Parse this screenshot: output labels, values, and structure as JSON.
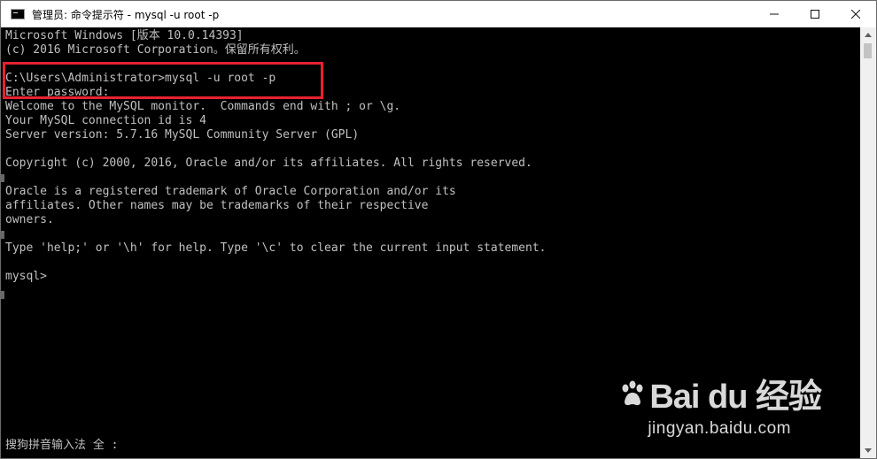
{
  "window": {
    "title": "管理员: 命令提示符 - mysql  -u root -p",
    "controls": {
      "minimize": "minimize-icon",
      "maximize": "maximize-icon",
      "close": "close-icon"
    }
  },
  "console": {
    "lines": [
      "Microsoft Windows [版本 10.0.14393]",
      "(c) 2016 Microsoft Corporation。保留所有权利。",
      "",
      "C:\\Users\\Administrator>mysql -u root -p",
      "Enter password:",
      "Welcome to the MySQL monitor.  Commands end with ; or \\g.",
      "Your MySQL connection id is 4",
      "Server version: 5.7.16 MySQL Community Server (GPL)",
      "",
      "Copyright (c) 2000, 2016, Oracle and/or its affiliates. All rights reserved.",
      "",
      "Oracle is a registered trademark of Oracle Corporation and/or its",
      "affiliates. Other names may be trademarks of their respective",
      "owners.",
      "",
      "Type 'help;' or '\\h' for help. Type '\\c' to clear the current input statement.",
      "",
      "mysql>"
    ],
    "ime_status": "搜狗拼音输入法 全 :"
  },
  "watermark": {
    "logo": "Bai du 经验",
    "url": "jingyan.baidu.com"
  },
  "colors": {
    "console_bg": "#000000",
    "console_fg": "#c0c0c0",
    "highlight": "#e8212f",
    "titlebar_bg": "#ffffff"
  }
}
